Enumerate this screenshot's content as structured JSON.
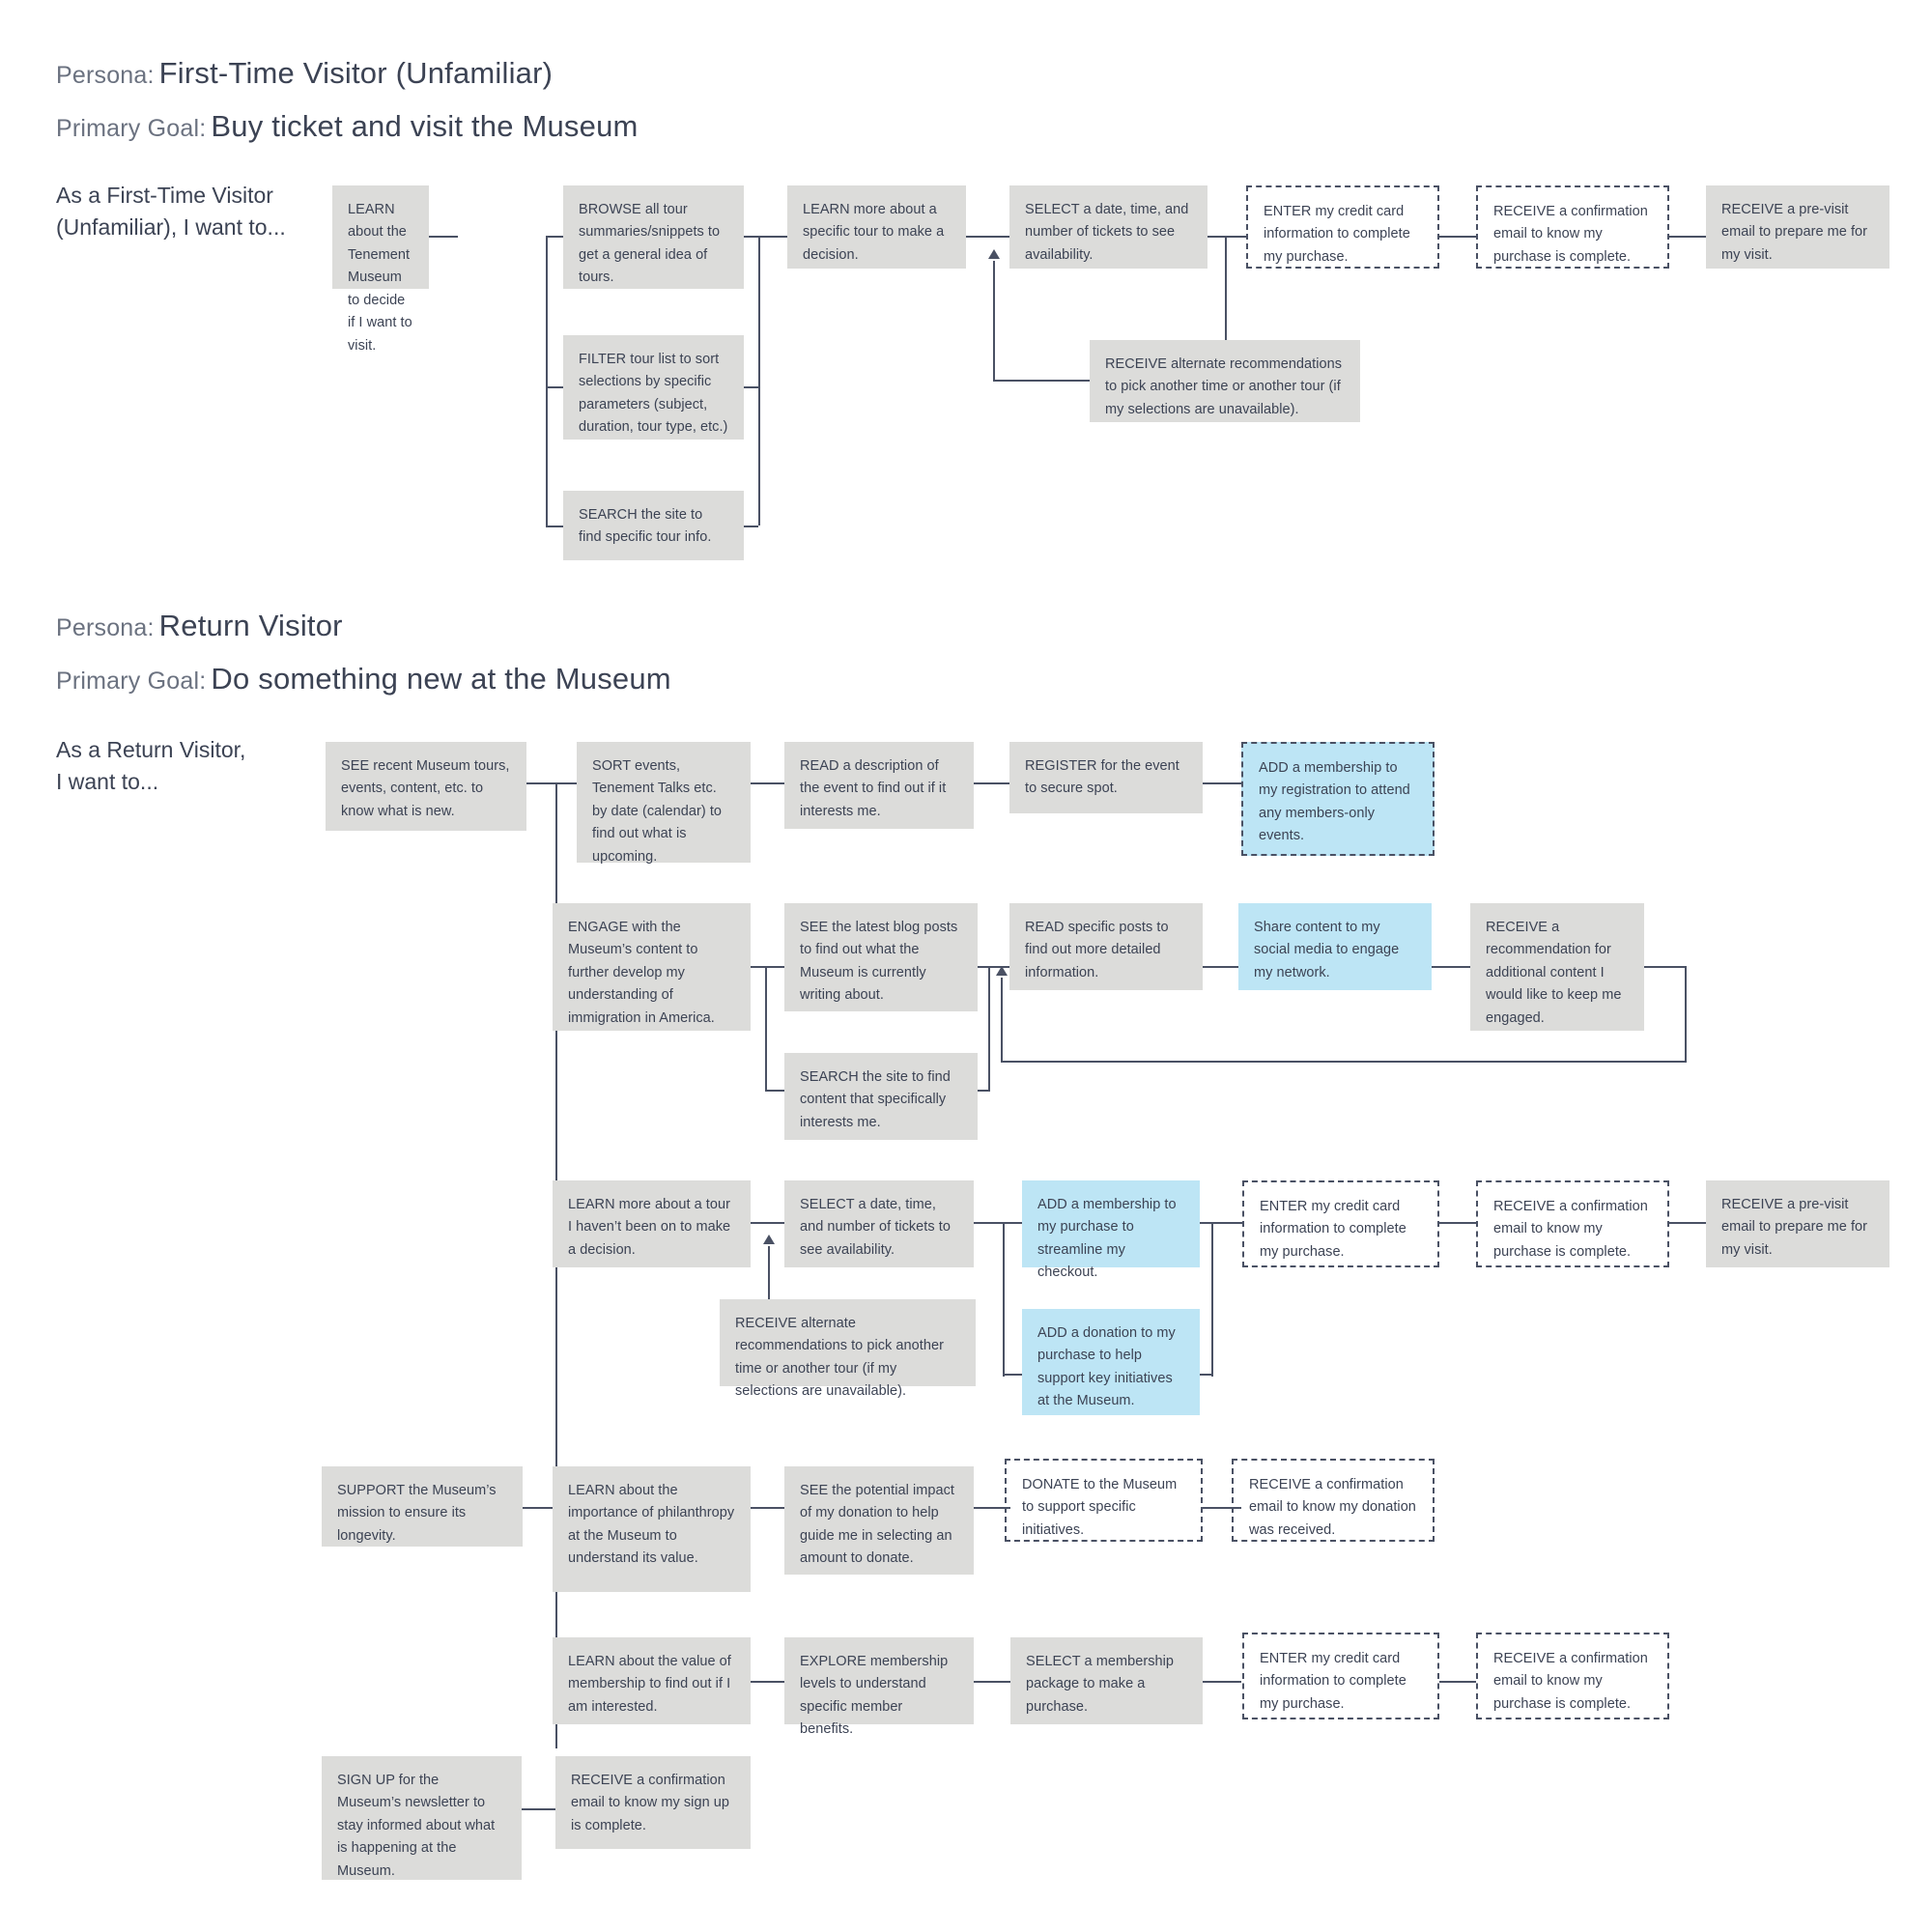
{
  "personas": [
    {
      "persona_label": "Persona:",
      "persona_value": "First-Time Visitor (Unfamiliar)",
      "goal_label": "Primary Goal:",
      "goal_value": "Buy ticket and visit the Museum",
      "row_label": "As a First-Time Visitor\n(Unfamiliar), I want to..."
    },
    {
      "persona_label": "Persona:",
      "persona_value": "Return Visitor",
      "goal_label": "Primary Goal:",
      "goal_value": "Do something new at the Museum",
      "row_label": "As a Return Visitor,\nI want to..."
    }
  ],
  "nodes": {
    "n1_learn_about": "LEARN about the Tenement Museum to decide if I want to visit.",
    "n1_browse": "BROWSE all tour summaries/snippets to get a general idea of tours.",
    "n1_filter": "FILTER tour list to sort selections by specific parameters (subject, duration, tour type, etc.)",
    "n1_search": "SEARCH the site to find specific tour info.",
    "n1_learn_more": "LEARN more about a specific tour to make a decision.",
    "n1_select_date": "SELECT a date, time, and number of tickets to see availability.",
    "n1_enter_card": "ENTER my credit card information to complete my purchase.",
    "n1_receive_conf": "RECEIVE a confirmation email to know my purchase is complete.",
    "n1_receive_previsit": "RECEIVE a pre-visit email to prepare me for my visit.",
    "n1_alternate": "RECEIVE alternate recommendations to pick another time or another tour (if my selections are unavailable).",
    "n2_see_recent": "SEE recent Museum tours, events, content, etc. to know what is new.",
    "n2_sort_events": "SORT events, Tenement Talks etc. by date (calendar) to find out what is upcoming.",
    "n2_read_desc": "READ a description of the event to find out if it interests me.",
    "n2_register": "REGISTER for the event to secure spot.",
    "n2_add_membership_reg": "ADD a membership to my registration to attend any members-only events.",
    "n2_engage": "ENGAGE with the Museum’s content to further develop my understanding of immigration in America.",
    "n2_see_blog": "SEE the latest blog posts to find out what the Museum is currently writing about.",
    "n2_read_posts": "READ specific posts to find out more detailed information.",
    "n2_share": "Share content to my social media to engage my network.",
    "n2_recommendation": "RECEIVE a recommendation for additional content I would like to keep me engaged.",
    "n2_search_content": "SEARCH the site to find content that specifically interests me.",
    "n2_learn_tour": "LEARN more about a tour I haven’t been on to make a decision.",
    "n2_select_date": "SELECT a date, time, and number of tickets to see availability.",
    "n2_add_membership_checkout": "ADD a membership to my purchase to streamline my checkout.",
    "n2_add_donation": "ADD a donation to my purchase to help support key initiatives at the Museum.",
    "n2_alternate": "RECEIVE alternate recommendations to pick another time or another tour (if my selections are unavailable).",
    "n2_enter_card": "ENTER my credit card information to complete my purchase.",
    "n2_receive_conf": "RECEIVE a confirmation email to know my purchase is complete.",
    "n2_receive_previsit": "RECEIVE a pre-visit email to prepare me for my visit.",
    "n3_support": "SUPPORT the Museum’s mission to ensure its longevity.",
    "n3_learn_philanthropy": "LEARN about the importance of philanthropy at the Museum to understand its value.",
    "n3_see_impact": "SEE the potential impact of my donation to  help guide me in selecting an amount to donate.",
    "n3_donate": "DONATE to the Museum to support specific initiatives.",
    "n3_receive_donation_conf": "RECEIVE a confirmation email to know my donation was received.",
    "n4_learn_membership": "LEARN about the value of membership to find out if I am interested.",
    "n4_explore_levels": "EXPLORE membership levels to understand specific member benefits.",
    "n4_select_package": "SELECT a membership package to make a purchase.",
    "n4_enter_card": "ENTER my credit card information to complete my purchase.",
    "n4_receive_conf": "RECEIVE a confirmation email to know my purchase is complete.",
    "n5_signup": "SIGN UP for the Museum’s newsletter to stay informed about what is happening at the Museum.",
    "n5_receive_conf": "RECEIVE a confirmation email to know my sign up is complete."
  },
  "colors": {
    "box_gray": "#dcdcda",
    "box_blue": "#bde5f5",
    "line": "#4a5164",
    "text": "#3c4354",
    "label_gray": "#6b7280",
    "background": "#ffffff"
  }
}
